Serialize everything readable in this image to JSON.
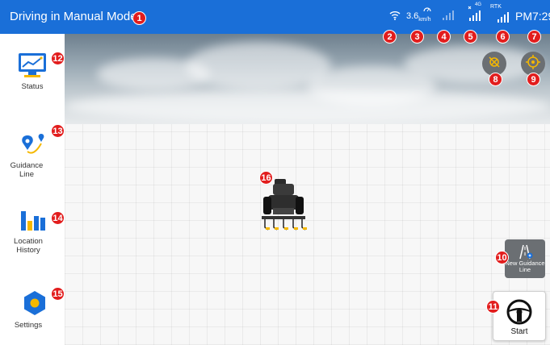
{
  "header": {
    "title": "Driving in Manual Mode",
    "speed_value": "3.6",
    "speed_unit": "km/h",
    "net_label": "4G",
    "rtk_label": "RTK",
    "time": "PM7:29"
  },
  "sidebar": {
    "items": [
      {
        "label": "Status",
        "icon": "status-monitor-icon"
      },
      {
        "label": "Guidance Line",
        "icon": "guidance-line-icon"
      },
      {
        "label": "Location History",
        "icon": "location-history-icon"
      },
      {
        "label": "Settings",
        "icon": "gear-icon"
      }
    ]
  },
  "actions": {
    "new_guidance_label": "New Guidance Line",
    "start_label": "Start"
  },
  "badges": [
    "1",
    "2",
    "3",
    "4",
    "5",
    "6",
    "7",
    "8",
    "9",
    "10",
    "11",
    "12",
    "13",
    "14",
    "15",
    "16"
  ],
  "colors": {
    "header": "#1a6fd8",
    "accent": "#1a6fd8",
    "badge": "#e21d1d",
    "button_gray": "#6b6f73",
    "icon_yellow": "#f5b800"
  }
}
